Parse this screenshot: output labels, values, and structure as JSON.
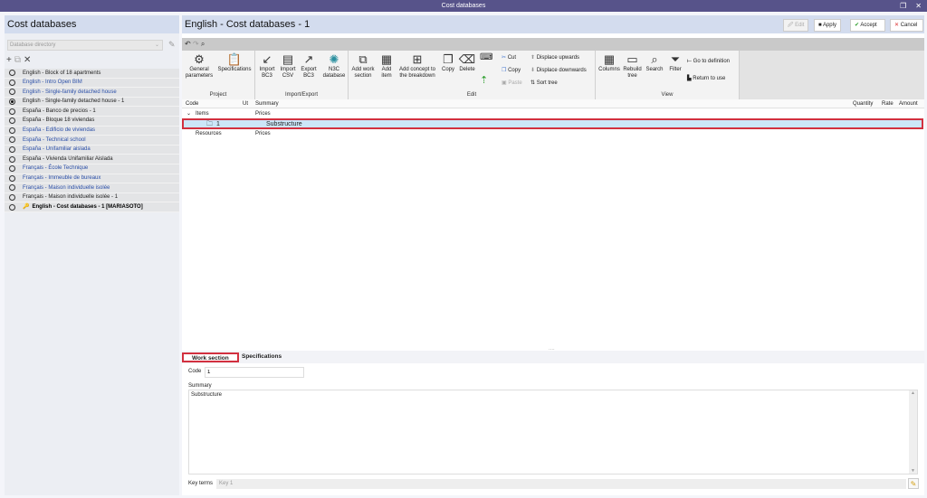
{
  "window": {
    "title": "Cost databases",
    "restore": "❐",
    "close": "✕"
  },
  "left": {
    "title": "Cost databases",
    "directory_placeholder": "Database directory",
    "items": [
      {
        "label": "English - Block of 18 apartments",
        "style": "",
        "selected": false
      },
      {
        "label": "English - Intro Open BIM",
        "style": "blue",
        "selected": false
      },
      {
        "label": "English - Single-family detached house",
        "style": "blue",
        "selected": false
      },
      {
        "label": "English - Single-family detached house - 1",
        "style": "",
        "selected": true
      },
      {
        "label": "España - Banco de precios - 1",
        "style": "",
        "selected": false
      },
      {
        "label": "España - Bloque 18 viviendas",
        "style": "",
        "selected": false
      },
      {
        "label": "España - Edificio de viviendas",
        "style": "blue",
        "selected": false
      },
      {
        "label": "España - Technical school",
        "style": "blue",
        "selected": false
      },
      {
        "label": "España - Unifamiliar aislada",
        "style": "blue",
        "selected": false
      },
      {
        "label": "España - Vivienda Unifamiliar Aislada",
        "style": "",
        "selected": false
      },
      {
        "label": "Français - École Technique",
        "style": "blue",
        "selected": false
      },
      {
        "label": "Français - Immeuble de bureaux",
        "style": "blue",
        "selected": false
      },
      {
        "label": "Français - Maison individuelle isolée",
        "style": "blue",
        "selected": false
      },
      {
        "label": "Français - Maison individuelle isolée - 1",
        "style": "",
        "selected": false
      },
      {
        "label": "English - Cost databases - 1 [MARIASOTO]",
        "style": "bold",
        "selected": false
      }
    ]
  },
  "main": {
    "title": "English - Cost databases - 1",
    "buttons": {
      "edit": "Edit",
      "apply": "Apply",
      "accept": "Accept",
      "cancel": "Cancel"
    },
    "ribbon": {
      "project": {
        "label": "Project",
        "general": "General parameters",
        "specs": "Specifications"
      },
      "io": {
        "label": "Import/Export",
        "import_bc3": "Import BC3",
        "import_csv": "Import CSV",
        "export_bc3": "Export BC3",
        "n3c": "N3C database"
      },
      "edit": {
        "label": "Edit",
        "add_ws": "Add work section",
        "add_item": "Add item",
        "add_concept": "Add concept to the breakdown",
        "copy": "Copy",
        "delete": "Delete",
        "cut": "Cut",
        "copy_sm": "Copy",
        "paste": "Paste",
        "up": "Displace upwards",
        "down": "Displace downwards",
        "sort": "Sort tree"
      },
      "view": {
        "label": "View",
        "columns": "Columns",
        "rebuild": "Rebuild tree",
        "search": "Search",
        "filter": "Filter",
        "goto": "Go to definition",
        "return": "Return to use"
      }
    },
    "table": {
      "headers": {
        "code": "Code",
        "ut": "Ut",
        "summary": "Summary",
        "quantity": "Quantity",
        "rate": "Rate",
        "amount": "Amount"
      },
      "rows": [
        {
          "code": "Items",
          "summary": "Prices"
        },
        {
          "code": "1",
          "summary": "Substructure"
        },
        {
          "code": "Resources",
          "summary": "Prices"
        }
      ]
    },
    "tabs": {
      "work_section": "Work section",
      "specifications": "Specifications"
    },
    "form": {
      "code_label": "Code",
      "code_value": "1",
      "summary_label": "Summary",
      "summary_value": "Substructure",
      "keyterms_label": "Key terms",
      "keyterms_placeholder": "Key 1"
    }
  }
}
